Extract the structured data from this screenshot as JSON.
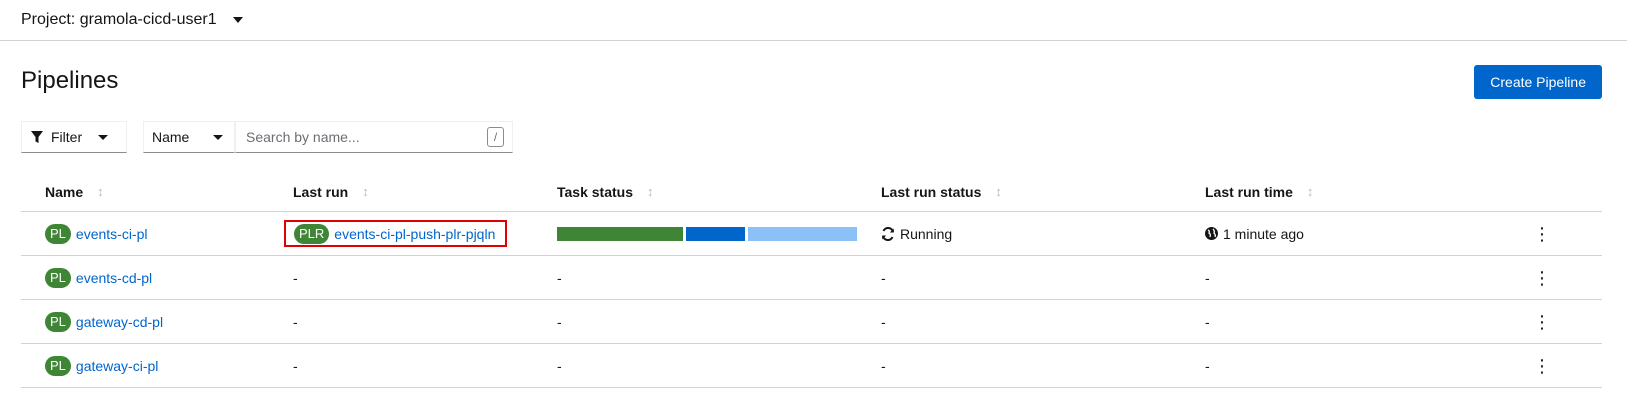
{
  "project": {
    "label": "Project: gramola-cicd-user1"
  },
  "page": {
    "title": "Pipelines",
    "create_button": "Create Pipeline"
  },
  "toolbar": {
    "filter_label": "Filter",
    "name_select": "Name",
    "search_placeholder": "Search by name...",
    "search_shortcut": "/"
  },
  "table": {
    "headers": [
      "Name",
      "Last run",
      "Task status",
      "Last run status",
      "Last run time"
    ],
    "rows": [
      {
        "badge": "PL",
        "name": "events-ci-pl",
        "last_run_badge": "PLR",
        "last_run": "events-ci-pl-push-plr-pjqln",
        "task_status": [
          {
            "status": "succeeded",
            "fraction": 0.43,
            "color": "#3e8635"
          },
          {
            "status": "running",
            "fraction": 0.2,
            "color": "#0066cc"
          },
          {
            "status": "pending",
            "fraction": 0.37,
            "color": "#8bc1f7"
          }
        ],
        "run_status": "Running",
        "run_time": "1 minute ago"
      },
      {
        "badge": "PL",
        "name": "events-cd-pl",
        "last_run": "-",
        "task_status_text": "-",
        "run_status": "-",
        "run_time": "-"
      },
      {
        "badge": "PL",
        "name": "gateway-cd-pl",
        "last_run": "-",
        "task_status_text": "-",
        "run_status": "-",
        "run_time": "-"
      },
      {
        "badge": "PL",
        "name": "gateway-ci-pl",
        "last_run": "-",
        "task_status_text": "-",
        "run_status": "-",
        "run_time": "-"
      }
    ]
  },
  "colors": {
    "primary": "#0066cc",
    "badge_green": "#3e8635",
    "highlight_red": "#e00000"
  },
  "icons": {
    "filter": "filter-icon",
    "sort": "sort-icon",
    "running": "sync-icon",
    "time": "globe-icon",
    "actions": "kebab-icon"
  }
}
